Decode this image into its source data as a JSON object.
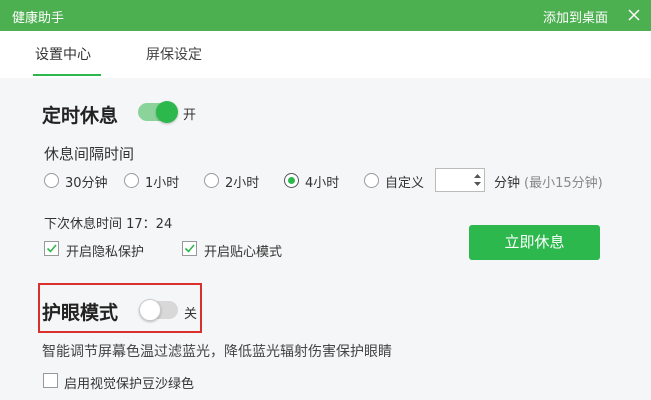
{
  "titlebar": {
    "app_title": "健康助手",
    "add_to_desktop": "添加到桌面"
  },
  "tabs": [
    {
      "label": "设置中心",
      "active": true
    },
    {
      "label": "屏保设定",
      "active": false
    }
  ],
  "timed_rest": {
    "title": "定时休息",
    "toggle_state": "开",
    "enabled": true,
    "interval_label": "休息间隔时间",
    "options": [
      "30分钟",
      "1小时",
      "2小时",
      "4小时",
      "自定义"
    ],
    "selected_option": "4小时",
    "custom_value": "",
    "custom_unit": "分钟",
    "custom_hint": "(最小15分钟)",
    "next_rest_label": "下次休息时间 17：24",
    "privacy_label": "开启隐私保护",
    "privacy_checked": true,
    "care_mode_label": "开启贴心模式",
    "care_mode_checked": true,
    "rest_now_button": "立即休息"
  },
  "eye_care": {
    "title": "护眼模式",
    "toggle_state": "关",
    "enabled": false,
    "description": "智能调节屏幕色温过滤蓝光，降低蓝光辐射伤害保护眼睛",
    "green_bg_label": "启用视觉保护豆沙绿色",
    "green_bg_checked": false
  },
  "colors": {
    "titlebar": "#4caf50",
    "accent": "#2db84d",
    "highlight_border": "#d9302c"
  }
}
